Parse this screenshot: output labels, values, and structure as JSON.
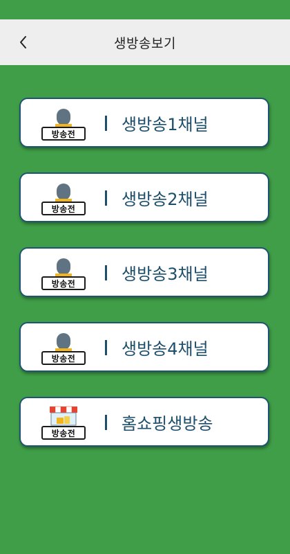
{
  "header": {
    "title": "생방송보기"
  },
  "channels": [
    {
      "label": "생방송1채널",
      "badge": "방송전",
      "icon": "microphone-icon"
    },
    {
      "label": "생방송2채널",
      "badge": "방송전",
      "icon": "microphone-icon"
    },
    {
      "label": "생방송3채널",
      "badge": "방송전",
      "icon": "microphone-icon"
    },
    {
      "label": "생방송4채널",
      "badge": "방송전",
      "icon": "microphone-icon"
    },
    {
      "label": "홈쇼핑생방송",
      "badge": "방송전",
      "icon": "shop-icon"
    }
  ],
  "colors": {
    "background": "#3f9e47",
    "header": "#eeeeee",
    "card_border": "#1d5573",
    "label_text": "#1d4e6b"
  }
}
